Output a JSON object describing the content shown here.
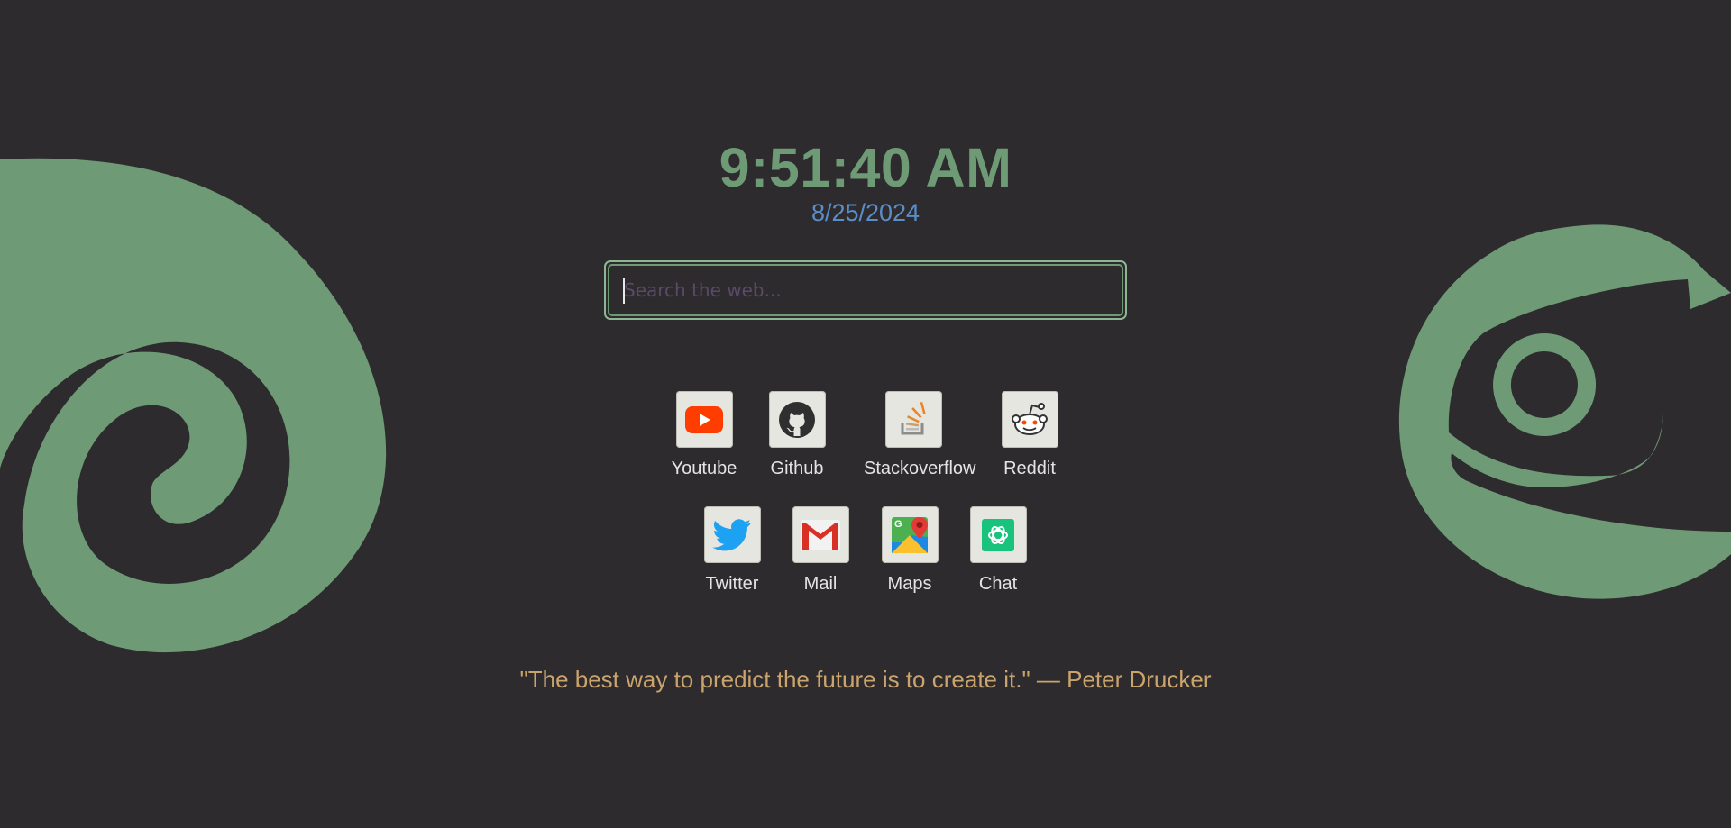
{
  "clock": {
    "time": "9:51:40 AM",
    "date": "8/25/2024"
  },
  "search": {
    "placeholder": "Search the web..."
  },
  "shortcuts": [
    {
      "label": "Youtube",
      "icon": "youtube-icon"
    },
    {
      "label": "Github",
      "icon": "github-icon"
    },
    {
      "label": "Stackoverflow",
      "icon": "stackoverflow-icon"
    },
    {
      "label": "Reddit",
      "icon": "reddit-icon"
    },
    {
      "label": "Twitter",
      "icon": "twitter-icon"
    },
    {
      "label": "Mail",
      "icon": "mail-icon"
    },
    {
      "label": "Maps",
      "icon": "maps-icon"
    },
    {
      "label": "Chat",
      "icon": "chat-icon"
    }
  ],
  "quote": {
    "text": "\"The best way to predict the future is to create it.\" — Peter Drucker"
  },
  "colors": {
    "background": "#2d2b2e",
    "accent_green": "#6e9a76",
    "date_blue": "#5b8ec9",
    "quote_gold": "#caa46c"
  }
}
